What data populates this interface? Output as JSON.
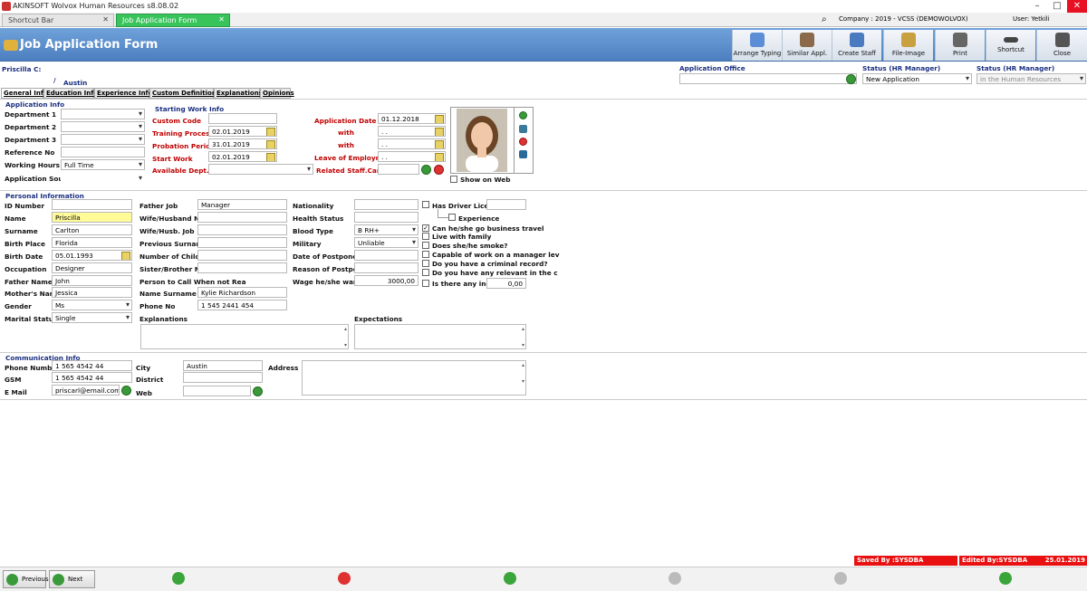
{
  "window": {
    "title": "AKINSOFT Wolvox Human Resources s8.08.02",
    "min": "–",
    "max": "□",
    "close": "✕"
  },
  "tabs": [
    {
      "label": "Shortcut Bar"
    },
    {
      "label": "Job Application Form"
    }
  ],
  "company": "Company : 2019 - VCSS (DEMOWOLVOX)",
  "user": "User: Yetkili",
  "header": {
    "title": "Job Application Form"
  },
  "toolbar": [
    {
      "label": "Arrange Typing",
      "icon": "arrange-typing-icon"
    },
    {
      "label": "Similar Appl.",
      "icon": "similar-applications-icon"
    },
    {
      "label": "Create Staff",
      "icon": "create-staff-icon"
    },
    {
      "label": "File-Image",
      "icon": "file-image-icon"
    },
    {
      "label": "Print",
      "icon": "printer-icon"
    },
    {
      "label": "Shortcut",
      "icon": "shortcut-icon"
    },
    {
      "label": "Close",
      "icon": "close-door-icon"
    }
  ],
  "applicant": {
    "short_name": "Priscilla C:",
    "slash": "/",
    "city": "Austin"
  },
  "office": {
    "label": "Application Office",
    "value": ""
  },
  "status_hr1": {
    "label": "Status (HR Manager)",
    "value": "New Application"
  },
  "status_hr2": {
    "label": "Status (HR Manager)",
    "value": "in the Human Resources"
  },
  "subtabs": [
    "General Info",
    "Education Info",
    "Experience Info",
    "Custom Definitions",
    "Explanations",
    "Opinions"
  ],
  "application_info": {
    "section": "Application Info",
    "department1": "Department 1",
    "department2": "Department 2",
    "department3": "Department 3",
    "reference": "Reference No",
    "working_hours": "Working Hours",
    "working_hours_value": "Full Time",
    "source": "Application Sourc"
  },
  "starting_work": {
    "section": "Starting Work Info",
    "custom_code": "Custom Code",
    "training": "Training Process",
    "training_value": "02.01.2019",
    "probation": "Probation Period",
    "probation_value": "31.01.2019",
    "start": "Start Work",
    "start_value": "02.01.2019",
    "dept": "Available Dept.",
    "app_date": "Application Date",
    "app_date_value": "01.12.2018",
    "with1": "with",
    "with1_value": ". .",
    "with2": "with",
    "with2_value": ". .",
    "leave": "Leave of Employme",
    "leave_value": ". .",
    "related": "Related Staff.Card"
  },
  "photo": {
    "show_on_web": "Show on Web"
  },
  "personal": {
    "section": "Personal Information",
    "id_number": "ID Number",
    "name": "Name",
    "name_value": "Priscilla",
    "surname": "Surname",
    "surname_value": "Carlton",
    "birth_place": "Birth Place",
    "birth_place_value": "Florida",
    "birth_date": "Birth Date",
    "birth_date_value": "05.01.1993",
    "occupation": "Occupation",
    "occupation_value": "Designer",
    "father_name": "Father Name",
    "father_name_value": "John",
    "mother_name": "Mother's Name",
    "mother_name_value": "Jessica",
    "gender": "Gender",
    "gender_value": "Ms",
    "marital": "Marital Status",
    "marital_value": "Single",
    "father_job": "Father Job",
    "father_job_value": "Manager",
    "wife_name": "Wife/Husband Nar",
    "wife_job": "Wife/Husb. Job",
    "prev_surname": "Previous Surnam",
    "children": "Number of Childre",
    "sister": "Sister/Brother Nu",
    "call": "Person to Call When not Rea",
    "nm_surname": "Name Surname",
    "nm_surname_value": "Kylie Richardson",
    "phone": "Phone No",
    "phone_value": "1 545 2441 454",
    "explanations": "Explanations",
    "nationality": "Nationality",
    "health": "Health Status",
    "blood": "Blood Type",
    "blood_value": "B RH+",
    "military": "Military",
    "military_value": "Unliable",
    "postpone_date": "Date of Postpone",
    "postpone_reason": "Reason of Postpo",
    "wage": "Wage he/she wan",
    "wage_value": "3000,00",
    "expectations": "Expectations",
    "driver": "Has Driver Licens",
    "experience": "Experience",
    "q1": "Can he/she go business travel",
    "q2": "Live with family",
    "q3": "Does she/he smoke?",
    "q4": "Capable of work  on a manager lev",
    "q5": "Do you have a criminal record?",
    "q6": "Do you have any relevant in the c",
    "q7": "Is there any inco",
    "q7_value": "0,00"
  },
  "communication": {
    "section": "Communication Info",
    "phone": "Phone Number",
    "phone_value": "1 565 4542 44",
    "gsm": "GSM",
    "gsm_value": "1 565 4542 44",
    "email": "E Mail",
    "email_value": "priscarl@email.com",
    "city": "City",
    "city_value": "Austin",
    "district": "District",
    "web": "Web",
    "address": "Address"
  },
  "status": {
    "saved": "Saved By :SYSDBA",
    "edited": "Edited By:SYSDBA",
    "date": "25.01.2019"
  },
  "footer": {
    "previous": "Previous",
    "next": "Next"
  }
}
